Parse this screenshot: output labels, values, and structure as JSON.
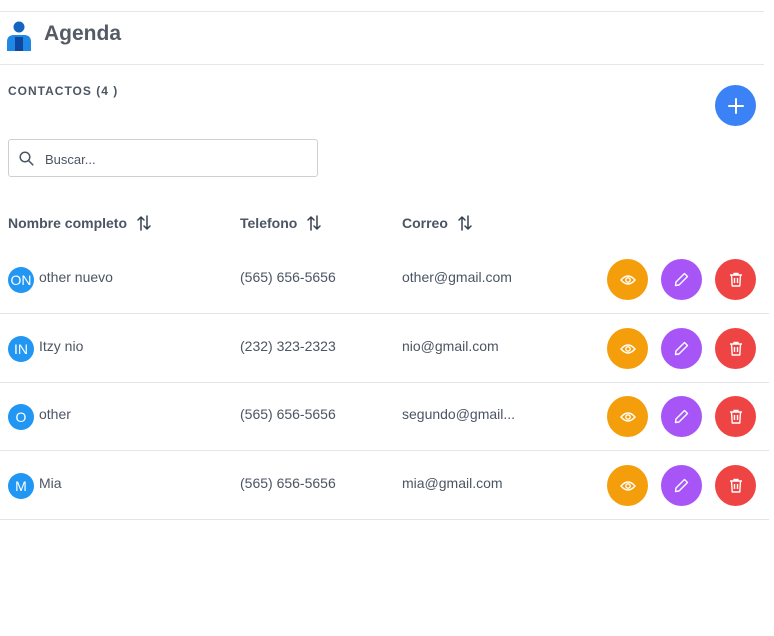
{
  "app": {
    "title": "Agenda"
  },
  "section": {
    "title": "CONTACTOS (4 )"
  },
  "search": {
    "placeholder": "Buscar..."
  },
  "table": {
    "columns": [
      {
        "label": "Nombre completo"
      },
      {
        "label": "Telefono"
      },
      {
        "label": "Correo"
      }
    ],
    "rows": [
      {
        "initials": "ON",
        "name": "other nuevo",
        "phone": "(565) 656-5656",
        "email": "other@gmail.com"
      },
      {
        "initials": "IN",
        "name": "Itzy nio",
        "phone": "(232) 323-2323",
        "email": "nio@gmail.com"
      },
      {
        "initials": "O",
        "name": "other",
        "phone": "(565) 656-5656",
        "email": "segundo@gmail..."
      },
      {
        "initials": "M",
        "name": "Mia",
        "phone": "(565) 656-5656",
        "email": "mia@gmail.com"
      }
    ]
  },
  "colors": {
    "primary": "#3b82f6",
    "avatar": "#2196f3",
    "view": "#f59e0b",
    "edit": "#a855f7",
    "delete": "#ef4444"
  },
  "icons": {
    "logo": "person-icon",
    "add": "plus-icon",
    "search": "search-icon",
    "sort": "sort-icon",
    "view": "eye-icon",
    "edit": "pencil-icon",
    "delete": "trash-icon"
  }
}
